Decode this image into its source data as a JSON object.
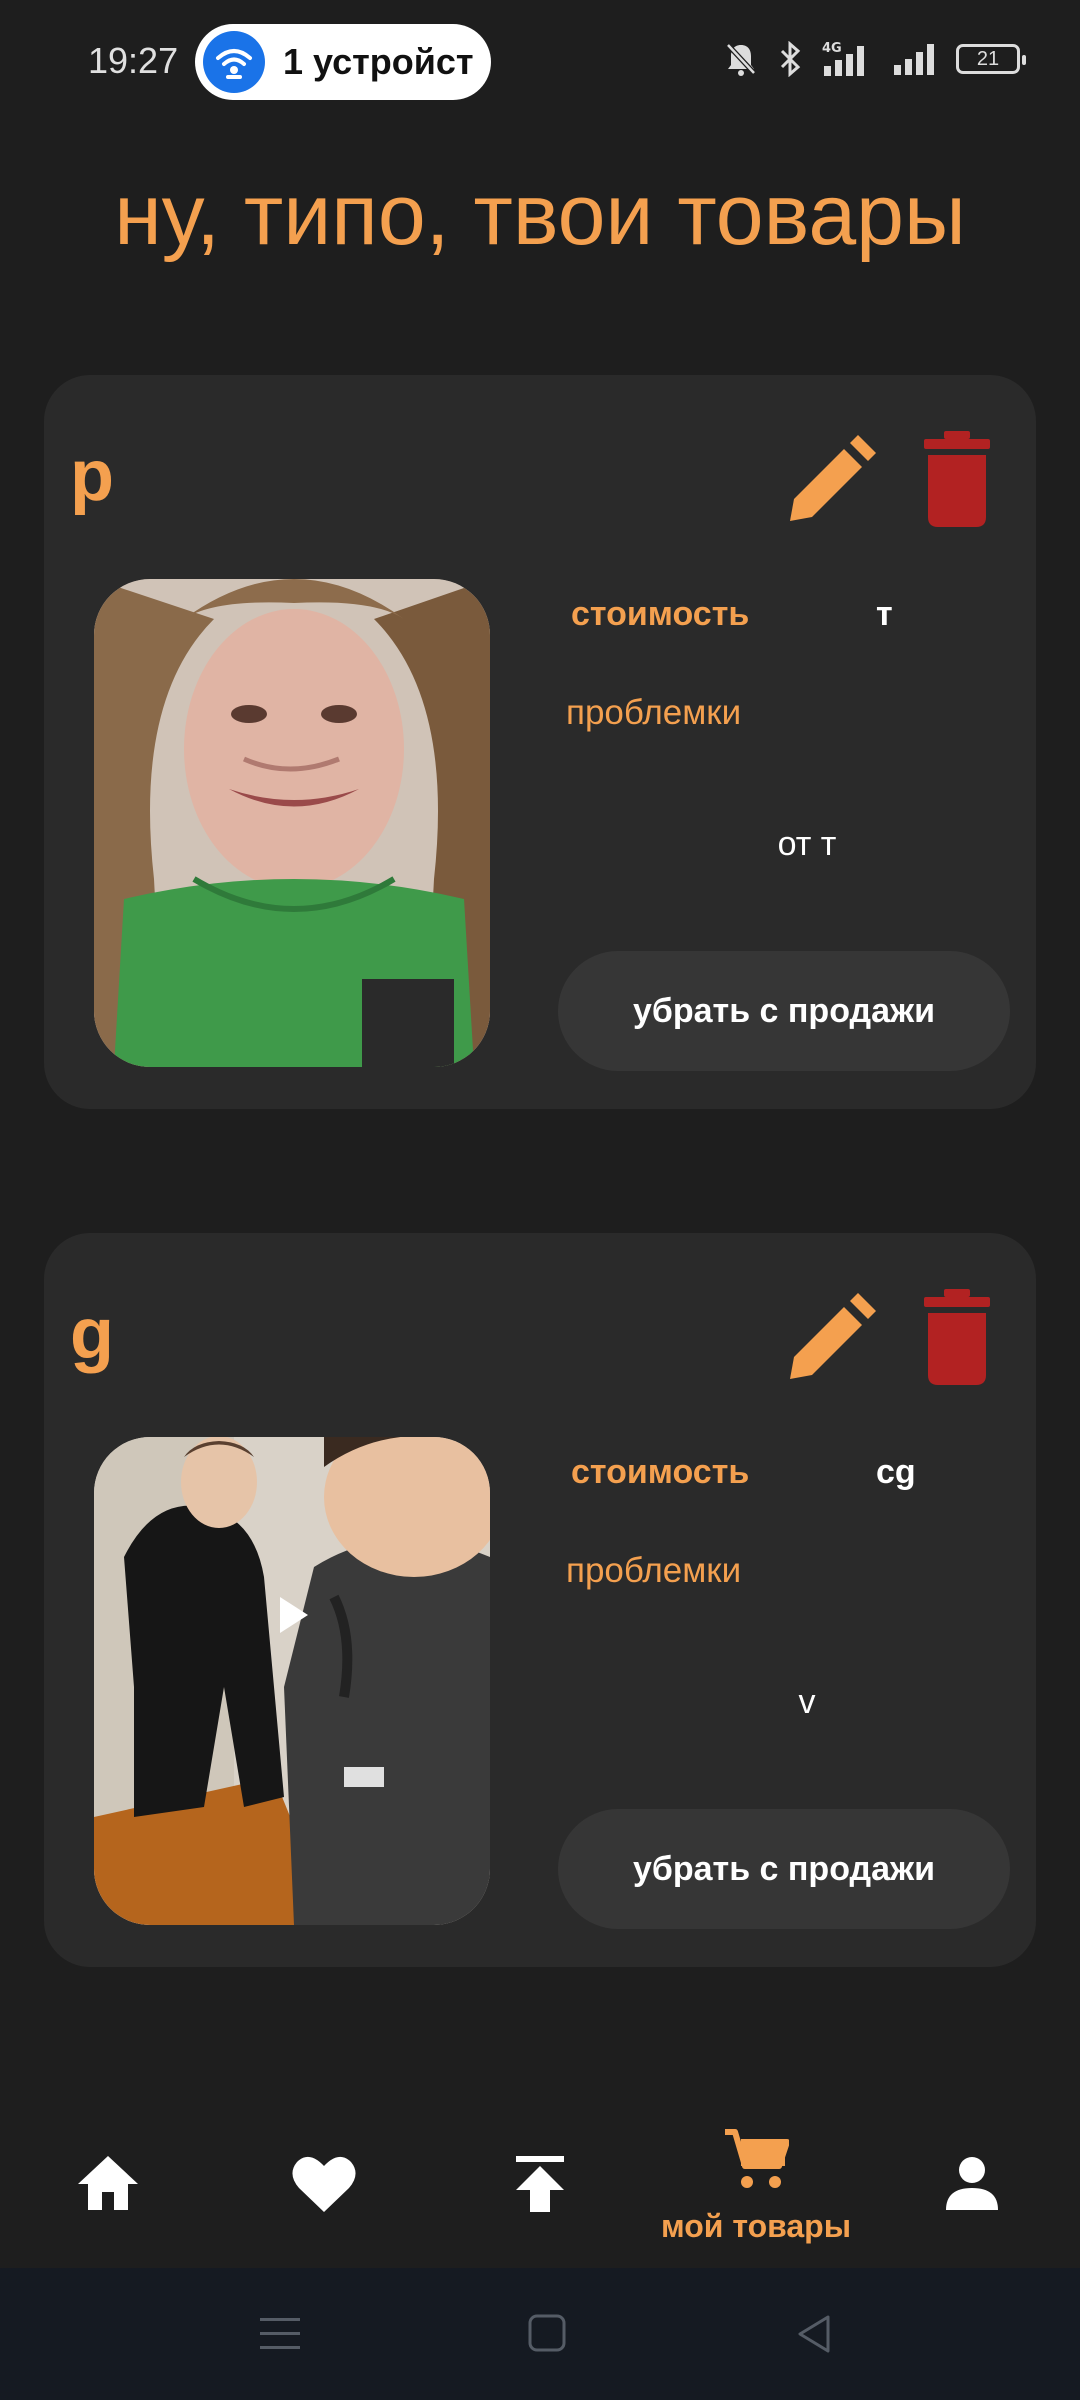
{
  "status_bar": {
    "time": "19:27",
    "hotspot_text": "1 устройст",
    "battery": "21",
    "network": "4G"
  },
  "page": {
    "title": "ну, типо, твои товары"
  },
  "products": [
    {
      "name": "р",
      "price_label": "стоимость",
      "price_value": "т",
      "problems_label": "проблемки",
      "problems_value": "от т",
      "remove_label": "убрать с продажи"
    },
    {
      "name": "g",
      "price_label": "стоимость",
      "price_value": "cg",
      "problems_label": "проблемки",
      "problems_value": "v",
      "remove_label": "убрать с продажи"
    }
  ],
  "bottom_nav": {
    "active_label": "мой товары",
    "items": [
      "home-icon",
      "heart-icon",
      "upload-icon",
      "cart-icon",
      "profile-icon"
    ]
  },
  "colors": {
    "accent": "#f4a04f",
    "delete": "#b22222",
    "background": "#1e1e1e",
    "card": "#2a2a2a"
  }
}
